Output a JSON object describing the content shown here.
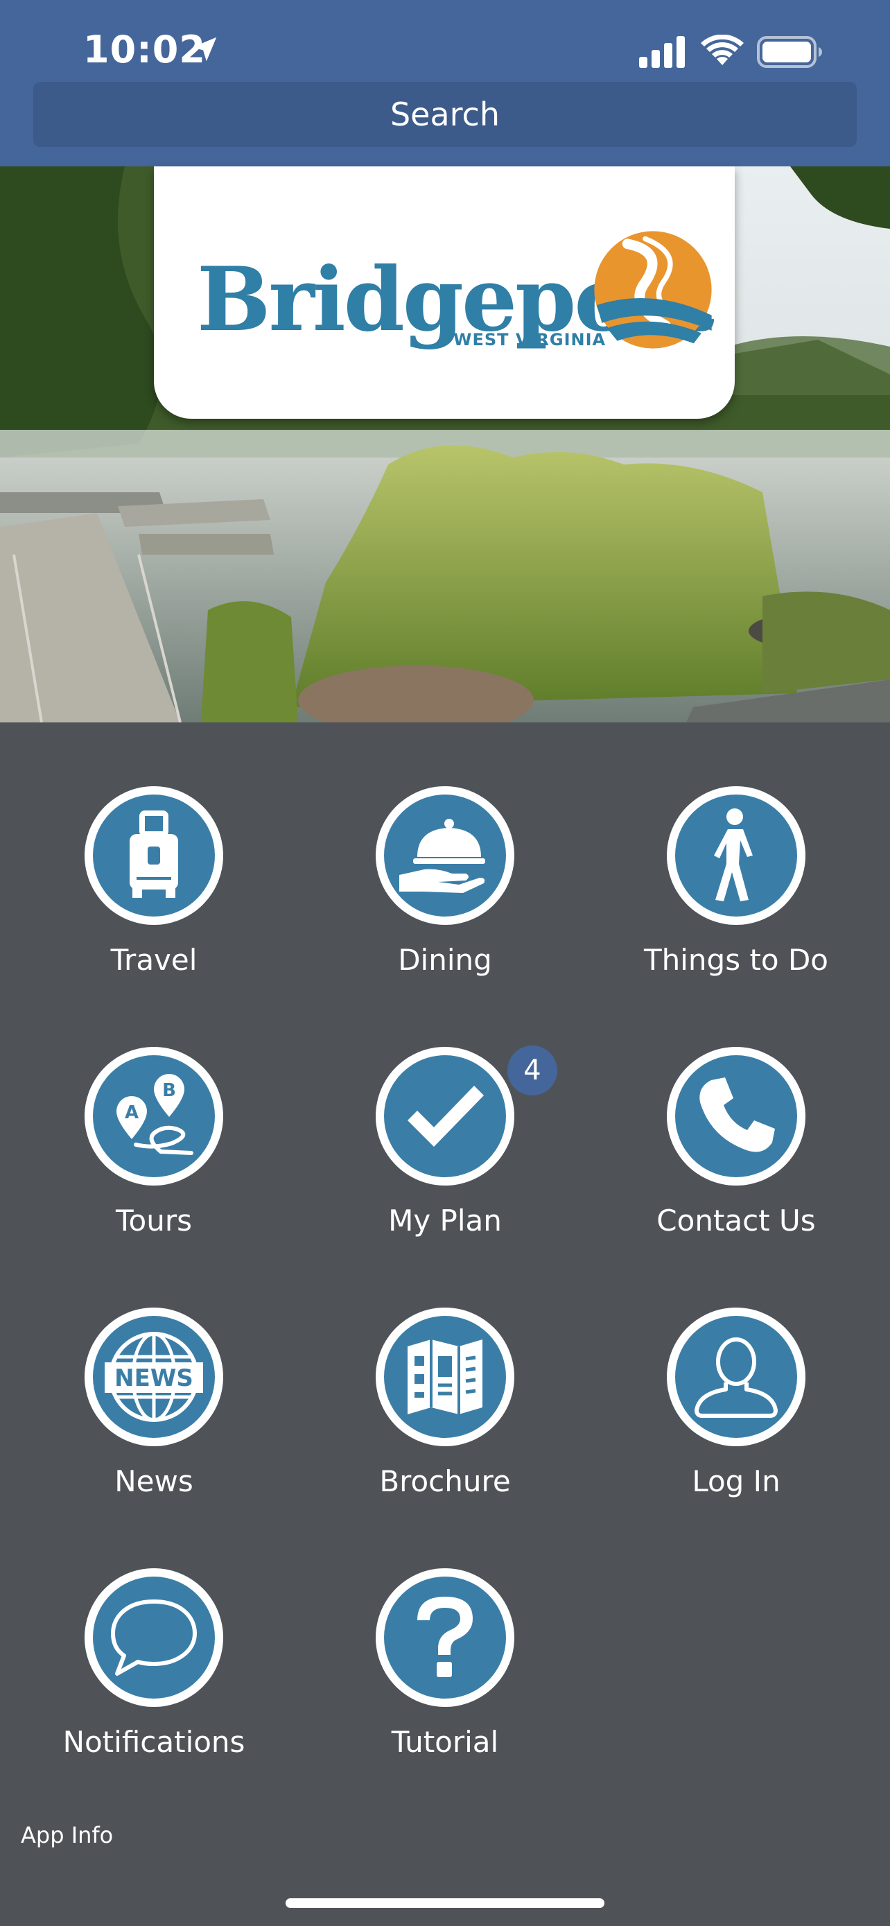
{
  "status_bar": {
    "time": "10:02",
    "icons": [
      "location-arrow-icon",
      "cellular-signal-icon",
      "wifi-icon",
      "battery-icon"
    ]
  },
  "search": {
    "label": "Search"
  },
  "logo": {
    "wordmark": "Bridgeport",
    "subtitle": "WEST VIRGINIA"
  },
  "menu": {
    "travel": {
      "label": "Travel",
      "icon": "luggage-icon"
    },
    "dining": {
      "label": "Dining",
      "icon": "cloche-icon"
    },
    "things_to_do": {
      "label": "Things to Do",
      "icon": "walking-person-icon"
    },
    "tours": {
      "label": "Tours",
      "icon": "route-pins-icon"
    },
    "my_plan": {
      "label": "My Plan",
      "icon": "checkmark-icon",
      "badge": "4"
    },
    "contact_us": {
      "label": "Contact Us",
      "icon": "phone-icon"
    },
    "news": {
      "label": "News",
      "icon": "news-globe-icon"
    },
    "brochure": {
      "label": "Brochure",
      "icon": "brochure-icon"
    },
    "log_in": {
      "label": "Log In",
      "icon": "user-icon"
    },
    "notifications": {
      "label": "Notifications",
      "icon": "speech-bubble-icon"
    },
    "tutorial": {
      "label": "Tutorial",
      "icon": "question-mark-icon"
    }
  },
  "footer": {
    "app_info": "App Info"
  },
  "colors": {
    "topbar": "#45669a",
    "search": "#3c5b8b",
    "background": "#4f5358",
    "icon_circle": "#3a7ea8",
    "brand_blue": "#2f7fa6",
    "brand_orange": "#e9952e"
  }
}
